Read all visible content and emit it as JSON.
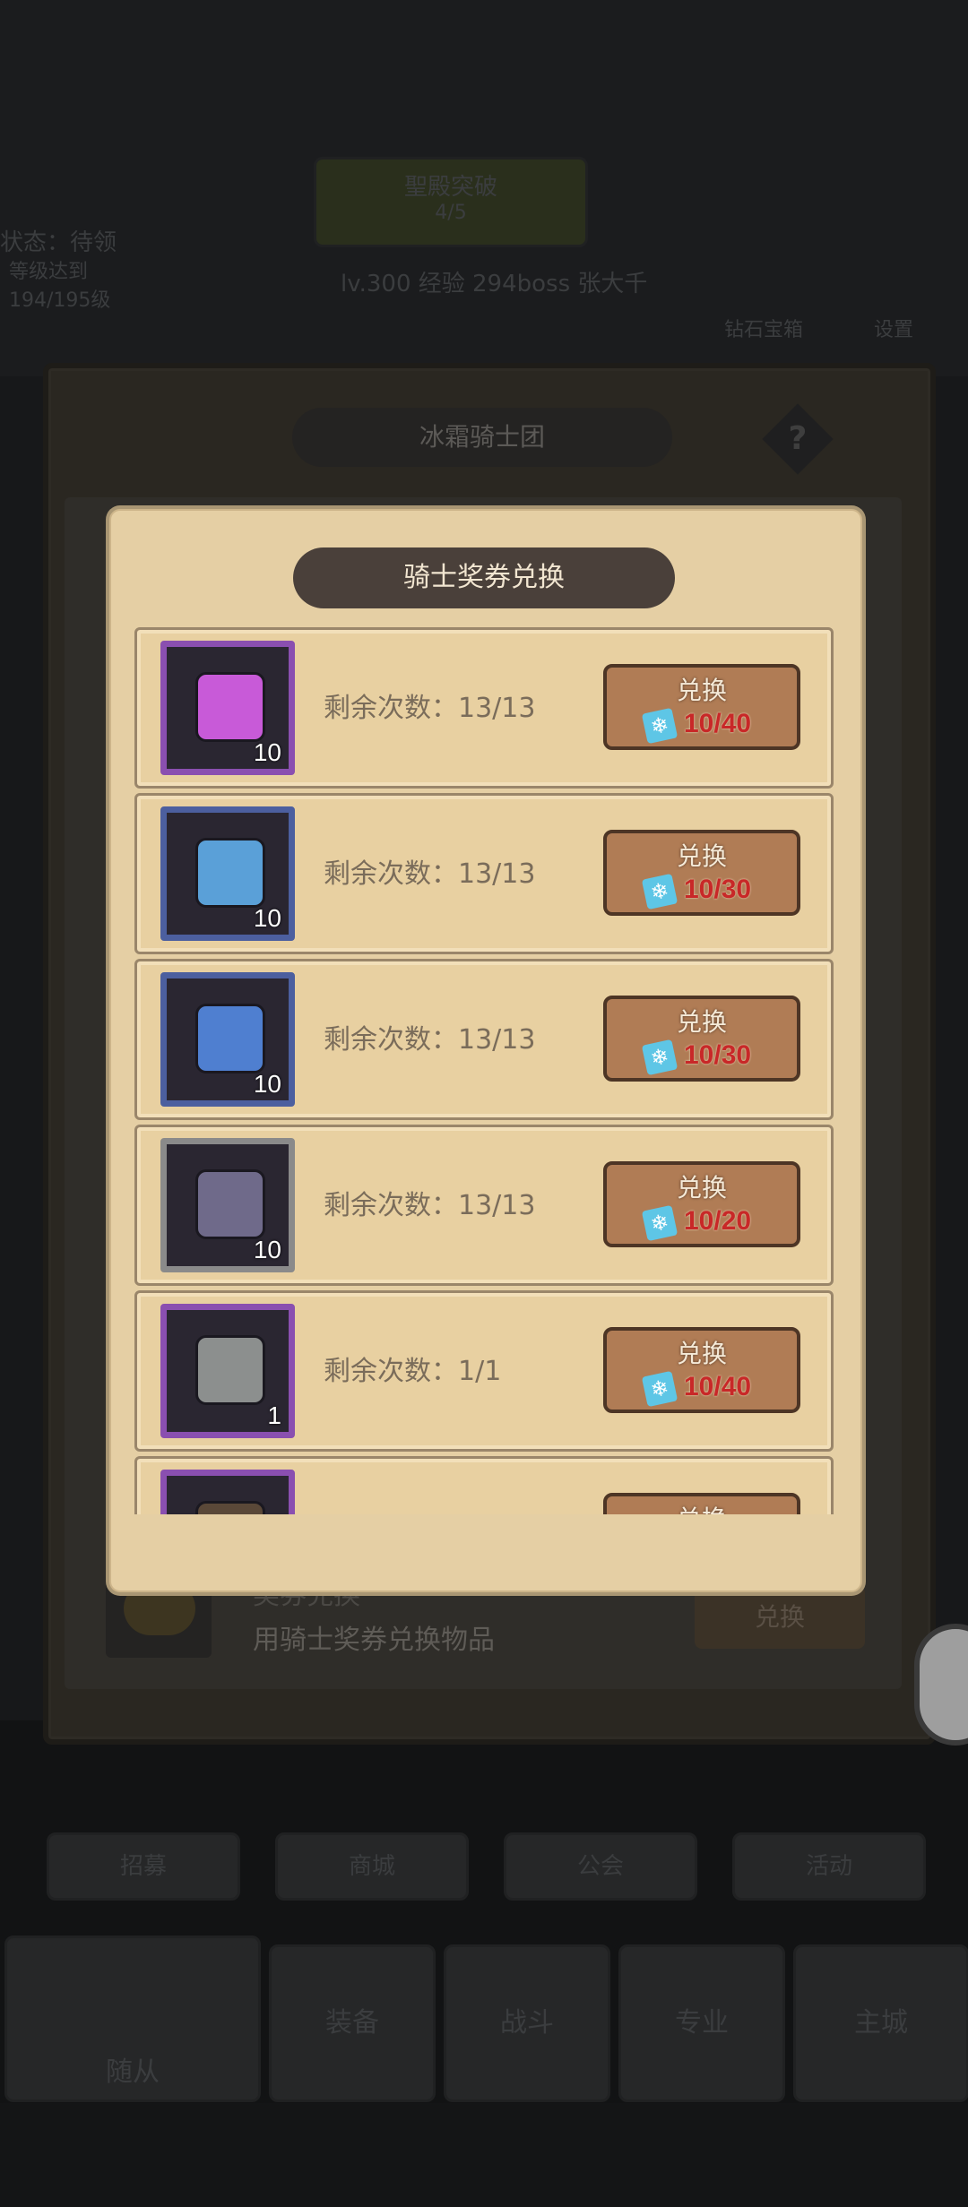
{
  "background": {
    "top_banner": "聖殿突破",
    "top_banner_sub": "4/5",
    "left_status": "状态：待领",
    "left_sub": "等级达到194/195级",
    "info_line": "lv.300 经验 294boss 张大千",
    "right_label_1": "钻石宝箱",
    "right_label_2": "设置",
    "bottom_row_labels": [
      "随从",
      "装备",
      "战斗",
      "专业",
      "主城"
    ],
    "mid_row_labels": [
      "招募",
      "商城",
      "公会",
      "活动"
    ]
  },
  "outer_panel": {
    "title": "冰霜骑士团",
    "help": "?",
    "exchange_title": "奖券兑换",
    "exchange_desc": "用骑士奖券兑换物品",
    "exchange_button": "兑换"
  },
  "dialog": {
    "title": "骑士奖券兑换",
    "items": [
      {
        "frame": "purple",
        "portrait_color": "#c85ad8",
        "count": "10",
        "remain": "剩余次数：13/13",
        "button": "兑换",
        "cost": "10/40"
      },
      {
        "frame": "blue",
        "portrait_color": "#5aa0d8",
        "count": "10",
        "remain": "剩余次数：13/13",
        "button": "兑换",
        "cost": "10/30"
      },
      {
        "frame": "blue",
        "portrait_color": "#4f7fd0",
        "count": "10",
        "remain": "剩余次数：13/13",
        "button": "兑换",
        "cost": "10/30"
      },
      {
        "frame": "gray",
        "portrait_color": "#6f6a8a",
        "count": "10",
        "remain": "剩余次数：13/13",
        "button": "兑换",
        "cost": "10/20"
      },
      {
        "frame": "purple",
        "portrait_color": "#8c8f8e",
        "count": "1",
        "remain": "剩余次数：1/1",
        "button": "兑换",
        "cost": "10/40"
      },
      {
        "frame": "purple",
        "portrait_color": "#5a4838",
        "count": "",
        "remain": "",
        "button": "兑换",
        "cost": ""
      }
    ]
  },
  "colors": {
    "cost_red": "#c82828",
    "dialog_bg": "#e5cfa4",
    "button_wood": "#b07c55"
  }
}
